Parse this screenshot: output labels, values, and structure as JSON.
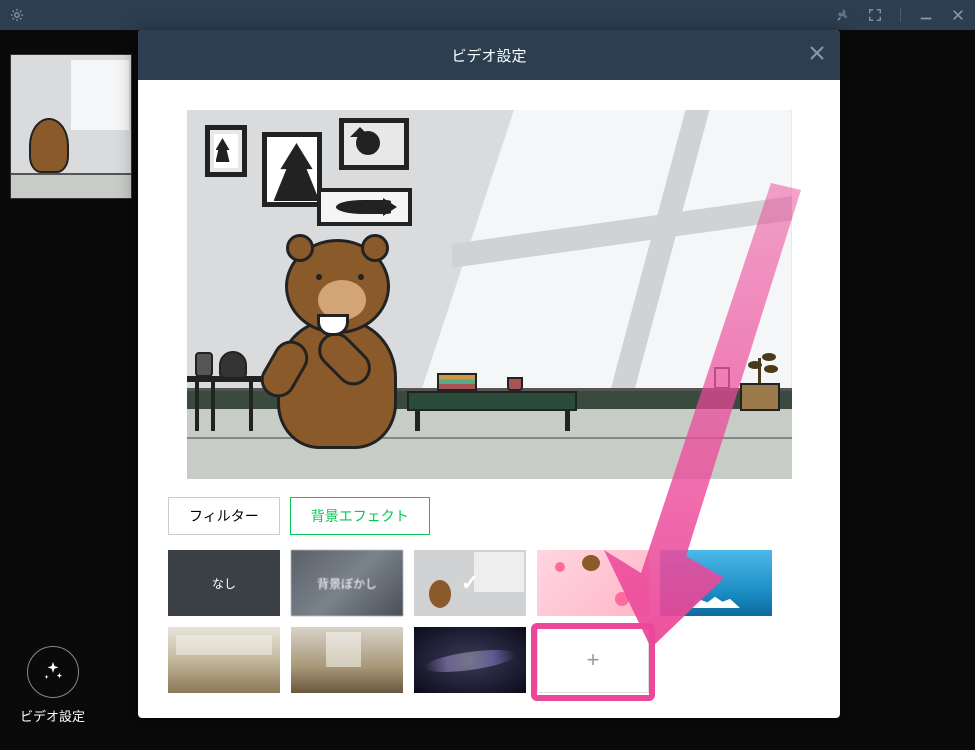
{
  "modal": {
    "title": "ビデオ設定"
  },
  "tabs": {
    "filter": "フィルター",
    "bgEffect": "背景エフェクト"
  },
  "tiles": {
    "none": "なし",
    "blur": "背景ぼかし",
    "add": "+"
  },
  "bottomButton": {
    "label": "ビデオ設定"
  }
}
